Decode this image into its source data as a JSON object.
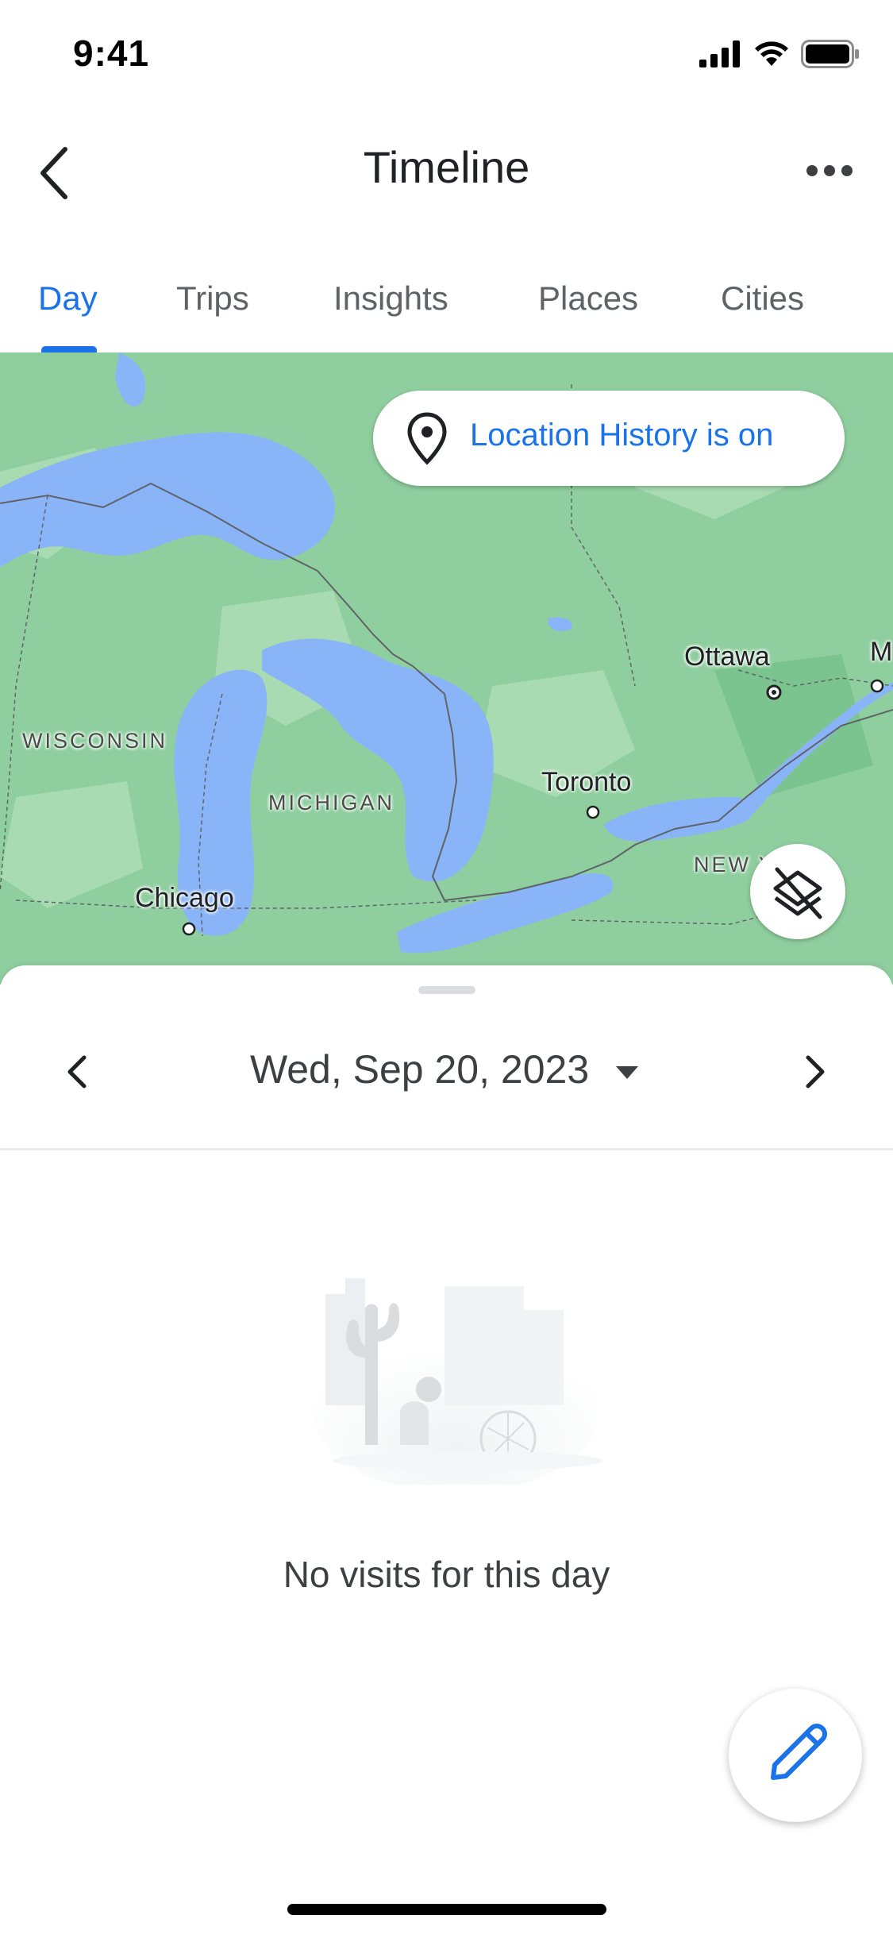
{
  "status_bar": {
    "time": "9:41",
    "icons": [
      "signal-icon",
      "wifi-icon",
      "battery-icon"
    ]
  },
  "header": {
    "title": "Timeline",
    "back_icon": "chevron-left-icon",
    "more_icon": "more-horizontal-icon"
  },
  "tabs": [
    {
      "label": "Day",
      "active": true
    },
    {
      "label": "Trips",
      "active": false
    },
    {
      "label": "Insights",
      "active": false
    },
    {
      "label": "Places",
      "active": false
    },
    {
      "label": "Cities",
      "active": false
    }
  ],
  "map": {
    "location_chip": {
      "label": "Location History is on",
      "icon": "location-pin-icon"
    },
    "labels": {
      "ottawa": "Ottawa",
      "m_partial": "M",
      "wisconsin": "WISCONSIN",
      "toronto": "Toronto",
      "michigan": "MICHIGAN",
      "new_york": "NEW Y",
      "chicago": "Chicago"
    },
    "layers_icon": "layers-off-icon",
    "colors": {
      "land": "#8fcf9f",
      "water": "#8ab4f8"
    }
  },
  "day_view": {
    "date": "Wed, Sep 20, 2023",
    "prev_icon": "chevron-left-icon",
    "next_icon": "chevron-right-icon",
    "dropdown_icon": "caret-down-icon",
    "empty_message": "No visits for this day",
    "illustration": "desert-cactus-illustration"
  },
  "fab": {
    "icon": "pencil-icon"
  },
  "accent_color": "#1a73e8"
}
